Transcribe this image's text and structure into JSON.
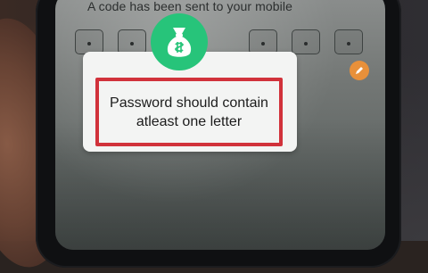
{
  "screen": {
    "instruction": "A code has been sent to your mobile",
    "otp_digits": [
      "",
      "",
      "",
      "",
      "",
      ""
    ]
  },
  "dialog": {
    "icon": "money-bag-icon",
    "message": "Password should contain atleast one letter"
  },
  "colors": {
    "badge": "#27c47a",
    "highlight": "#d1323b",
    "dialog_bg": "#f3f4f3",
    "accent_orange": "#e8903a"
  }
}
